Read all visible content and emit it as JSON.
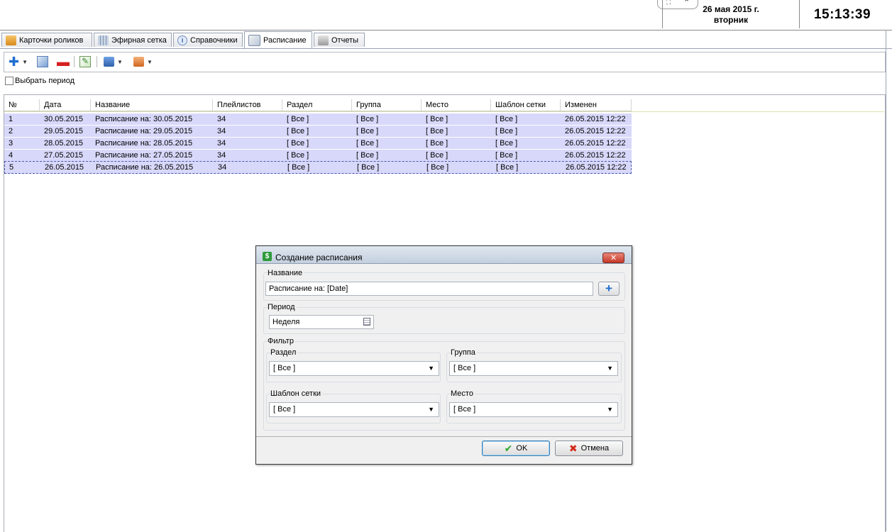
{
  "header": {
    "date_line1": "26 мая 2015 г.",
    "date_line2": "вторник",
    "clock": "15:13:39"
  },
  "tabs": [
    {
      "label": "Карточки роликов",
      "icon": "cards-icon"
    },
    {
      "label": "Эфирная сетка",
      "icon": "grid-icon"
    },
    {
      "label": "Справочники",
      "icon": "info-icon"
    },
    {
      "label": "Расписание",
      "icon": "schedule-icon",
      "active": true
    },
    {
      "label": "Отчеты",
      "icon": "printer-icon"
    }
  ],
  "toolbar": {
    "period_label": "Выбрать период"
  },
  "grid": {
    "columns": [
      "№",
      "Дата",
      "Название",
      "Плейлистов",
      "Раздел",
      "Группа",
      "Место",
      "Шаблон сетки",
      "Изменен"
    ],
    "rows": [
      [
        "1",
        "30.05.2015",
        "Расписание на: 30.05.2015",
        "34",
        "[ Все ]",
        "[ Все ]",
        "[ Все ]",
        "[ Все ]",
        "26.05.2015 12:22"
      ],
      [
        "2",
        "29.05.2015",
        "Расписание на: 29.05.2015",
        "34",
        "[ Все ]",
        "[ Все ]",
        "[ Все ]",
        "[ Все ]",
        "26.05.2015 12:22"
      ],
      [
        "3",
        "28.05.2015",
        "Расписание на: 28.05.2015",
        "34",
        "[ Все ]",
        "[ Все ]",
        "[ Все ]",
        "[ Все ]",
        "26.05.2015 12:22"
      ],
      [
        "4",
        "27.05.2015",
        "Расписание на: 27.05.2015",
        "34",
        "[ Все ]",
        "[ Все ]",
        "[ Все ]",
        "[ Все ]",
        "26.05.2015 12:22"
      ],
      [
        "5",
        "26.05.2015",
        "Расписание на: 26.05.2015",
        "34",
        "[ Все ]",
        "[ Все ]",
        "[ Все ]",
        "[ Все ]",
        "26.05.2015 12:22"
      ]
    ]
  },
  "dialog": {
    "title": "Создание расписания",
    "name_group": "Название",
    "name_value": "Расписание на: [Date]",
    "period_group": "Период",
    "period_value": "Неделя",
    "filter_group": "Фильтр",
    "section_label": "Раздел",
    "section_value": "[ Все ]",
    "group_label": "Группа",
    "group_value": "[ Все ]",
    "template_label": "Шаблон сетки",
    "template_value": "[ Все ]",
    "place_label": "Место",
    "place_value": "[ Все ]",
    "ok_label": "OK",
    "cancel_label": "Отмена"
  }
}
